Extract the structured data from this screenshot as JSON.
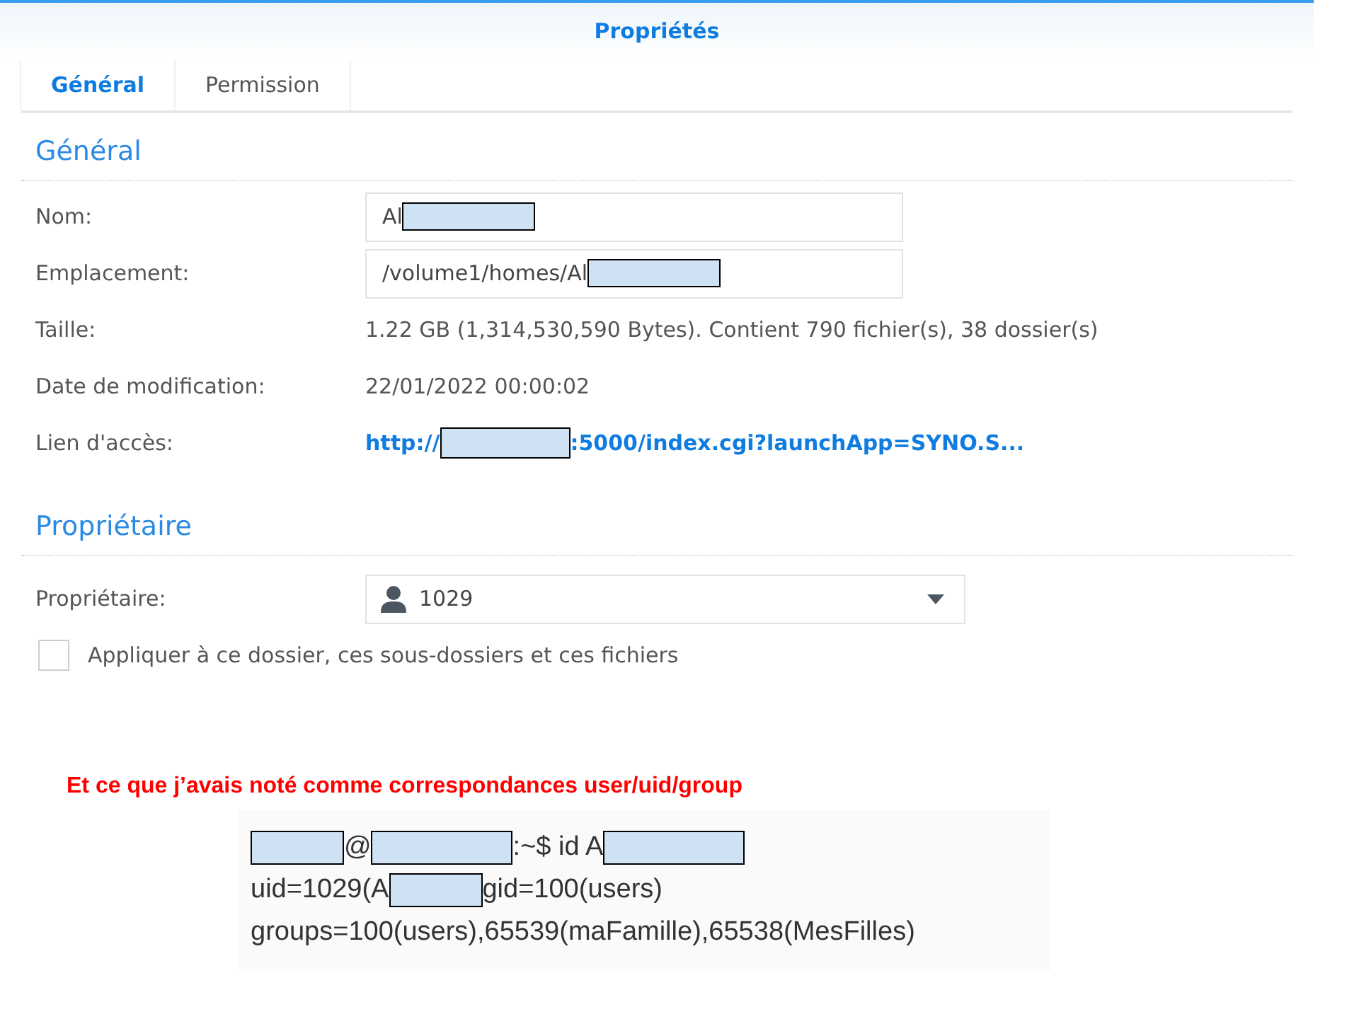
{
  "window": {
    "title": "Propriétés"
  },
  "tabs": [
    {
      "label": "Général",
      "selected": true
    },
    {
      "label": "Permission",
      "selected": false
    }
  ],
  "general": {
    "heading": "Général",
    "rows": [
      {
        "kind": "field",
        "label": "Nom:",
        "value": [
          {
            "kind": "text",
            "text": "Al"
          },
          {
            "kind": "redacted"
          }
        ]
      },
      {
        "kind": "field",
        "label": "Emplacement:",
        "value": [
          {
            "kind": "text",
            "text": "/volume1/homes/Al"
          },
          {
            "kind": "redacted"
          }
        ]
      },
      {
        "kind": "text",
        "label": "Taille:",
        "value": [
          {
            "kind": "text",
            "text": "1.22 GB (1,314,530,590 Bytes). Contient 790 fichier(s), 38 dossier(s)"
          }
        ]
      },
      {
        "kind": "text",
        "label": "Date de modification:",
        "value": [
          {
            "kind": "text",
            "text": "22/01/2022 00:00:02"
          }
        ]
      },
      {
        "kind": "link",
        "label": "Lien d'accès:",
        "value": [
          {
            "kind": "text",
            "text": "http://"
          },
          {
            "kind": "redacted"
          },
          {
            "kind": "text",
            "text": ":5000/index.cgi?launchApp=SYNO.S..."
          }
        ]
      }
    ]
  },
  "owner": {
    "heading": "Propriétaire",
    "label": "Propriétaire:",
    "value": "1029",
    "apply": {
      "label": "Appliquer à ce dossier, ces sous-dossiers et ces fichiers",
      "checked": false
    }
  },
  "note": "Et ce que j’avais noté comme correspondances user/uid/group",
  "terminal": {
    "lines": [
      [
        {
          "kind": "redacted"
        },
        {
          "kind": "text",
          "text": "@"
        },
        {
          "kind": "redacted_long"
        },
        {
          "kind": "text",
          "text": ":~$ id A"
        },
        {
          "kind": "redacted_long"
        }
      ],
      [
        {
          "kind": "text",
          "text": "uid=1029(A"
        },
        {
          "kind": "redacted"
        },
        {
          "kind": "text",
          "text": "gid=100(users)"
        }
      ],
      [
        {
          "kind": "text",
          "text": "groups=100(users),65539(maFamille),65538(MesFilles)"
        }
      ]
    ]
  }
}
